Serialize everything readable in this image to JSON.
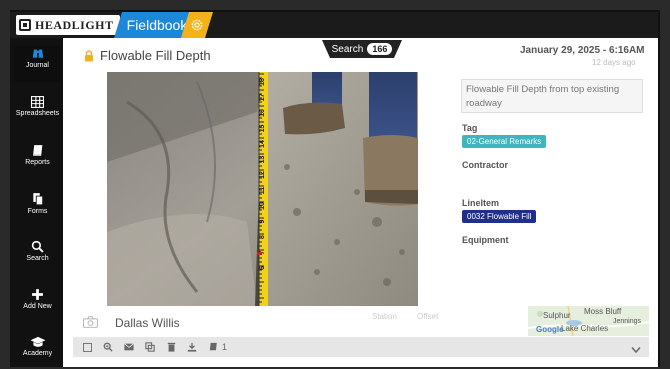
{
  "header": {
    "brand": "HEADLIGHT",
    "app_name": "Fieldbook"
  },
  "sidebar": {
    "items": [
      {
        "label": "Journal"
      },
      {
        "label": "Spreadsheets"
      },
      {
        "label": "Reports"
      },
      {
        "label": "Forms"
      },
      {
        "label": "Search"
      },
      {
        "label": "Add New"
      },
      {
        "label": "Academy"
      }
    ]
  },
  "search": {
    "label": "Search",
    "count": "166"
  },
  "entry": {
    "title": "Flowable Fill Depth",
    "date": "January 29, 2025 - 6:16AM",
    "relative_time": "12 days ago",
    "description": "Flowable Fill Depth from top existing roadway",
    "tag_label": "Tag",
    "tag_value": "02-General Remarks",
    "contractor_label": "Contractor",
    "lineitem_label": "LineItem",
    "lineitem_value": "0032 Flowable Fill",
    "equipment_label": "Equipment",
    "author": "Dallas Willis",
    "station_label": "Station",
    "offset_label": "Offset"
  },
  "map": {
    "labels": [
      "Sulphur",
      "Moss Bluff",
      "Lake Charles",
      "Jennings",
      "Google"
    ]
  },
  "toolbar": {
    "attachment_count": "1"
  },
  "ruler": {
    "numbers": [
      "18",
      "17",
      "16",
      "15",
      "14",
      "13",
      "12",
      "11",
      "10",
      "9",
      "8",
      "7",
      "6"
    ]
  },
  "colors": {
    "accent_blue": "#1e88d8",
    "accent_yellow": "#f3b21b",
    "tag_teal": "#3db6c0",
    "lineitem_navy": "#1f2f8a"
  }
}
